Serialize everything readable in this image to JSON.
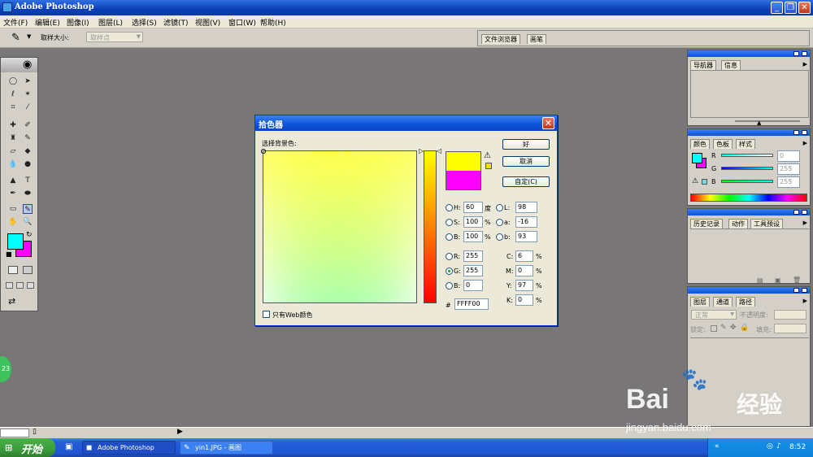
{
  "app": {
    "title": "Adobe Photoshop",
    "icon": "photoshop-app-icon"
  },
  "menu": [
    "文件(F)",
    "编辑(E)",
    "图像(I)",
    "图层(L)",
    "选择(S)",
    "滤镜(T)",
    "视图(V)",
    "窗口(W)",
    "帮助(H)"
  ],
  "options": {
    "sample_size_label": "取样大小:",
    "sample_size_value": "取样点",
    "tabs": [
      "文件浏览器",
      "画笔"
    ]
  },
  "dialog": {
    "title": "拾色器",
    "subtitle": "选择背景色:",
    "buttons": {
      "ok": "好",
      "cancel": "取消",
      "custom": "自定(C)"
    },
    "web_only": "只有Web颜色",
    "new_color": "#FFFF00",
    "old_color": "#FF00FF",
    "hsb": [
      {
        "label": "H:",
        "value": "60",
        "unit": "度",
        "selected": false
      },
      {
        "label": "S:",
        "value": "100",
        "unit": "%",
        "selected": false
      },
      {
        "label": "B:",
        "value": "100",
        "unit": "%",
        "selected": false
      }
    ],
    "lab": [
      {
        "label": "L:",
        "value": "98",
        "selected": false
      },
      {
        "label": "a:",
        "value": "-16",
        "selected": false
      },
      {
        "label": "b:",
        "value": "93",
        "selected": false
      }
    ],
    "rgb": [
      {
        "label": "R:",
        "value": "255",
        "selected": false
      },
      {
        "label": "G:",
        "value": "255",
        "selected": true
      },
      {
        "label": "B:",
        "value": "0",
        "selected": false
      }
    ],
    "cmyk": [
      {
        "label": "C:",
        "value": "6",
        "unit": "%"
      },
      {
        "label": "M:",
        "value": "0",
        "unit": "%"
      },
      {
        "label": "Y:",
        "value": "97",
        "unit": "%"
      },
      {
        "label": "K:",
        "value": "0",
        "unit": "%"
      }
    ],
    "hex_label": "#",
    "hex": "FFFF00"
  },
  "panels": {
    "navigator_tabs": [
      "导航器",
      "信息"
    ],
    "color_tabs": [
      "颜色",
      "色板",
      "样式"
    ],
    "color_sliders": [
      {
        "label": "R",
        "value": "0"
      },
      {
        "label": "G",
        "value": "255"
      },
      {
        "label": "B",
        "value": "255"
      }
    ],
    "history_tabs": [
      "历史记录",
      "动作",
      "工具预设"
    ],
    "layers_tabs": [
      "图层",
      "通道",
      "路径"
    ],
    "blend_mode": "正常",
    "opacity_label": "不透明度:",
    "lock_label": "锁定:",
    "fill_label": "填充:"
  },
  "toolbox": {
    "foreground": "#00FFFF",
    "background": "#FF00FF"
  },
  "left_badge": "23",
  "taskbar": {
    "start": "开始",
    "items": [
      "Adobe Photoshop",
      "yin1.JPG - 画图"
    ],
    "clock": "8:52"
  },
  "watermark": {
    "brand": "Bai",
    "brand2": "经验",
    "url": "jingyan.baidu.com"
  }
}
